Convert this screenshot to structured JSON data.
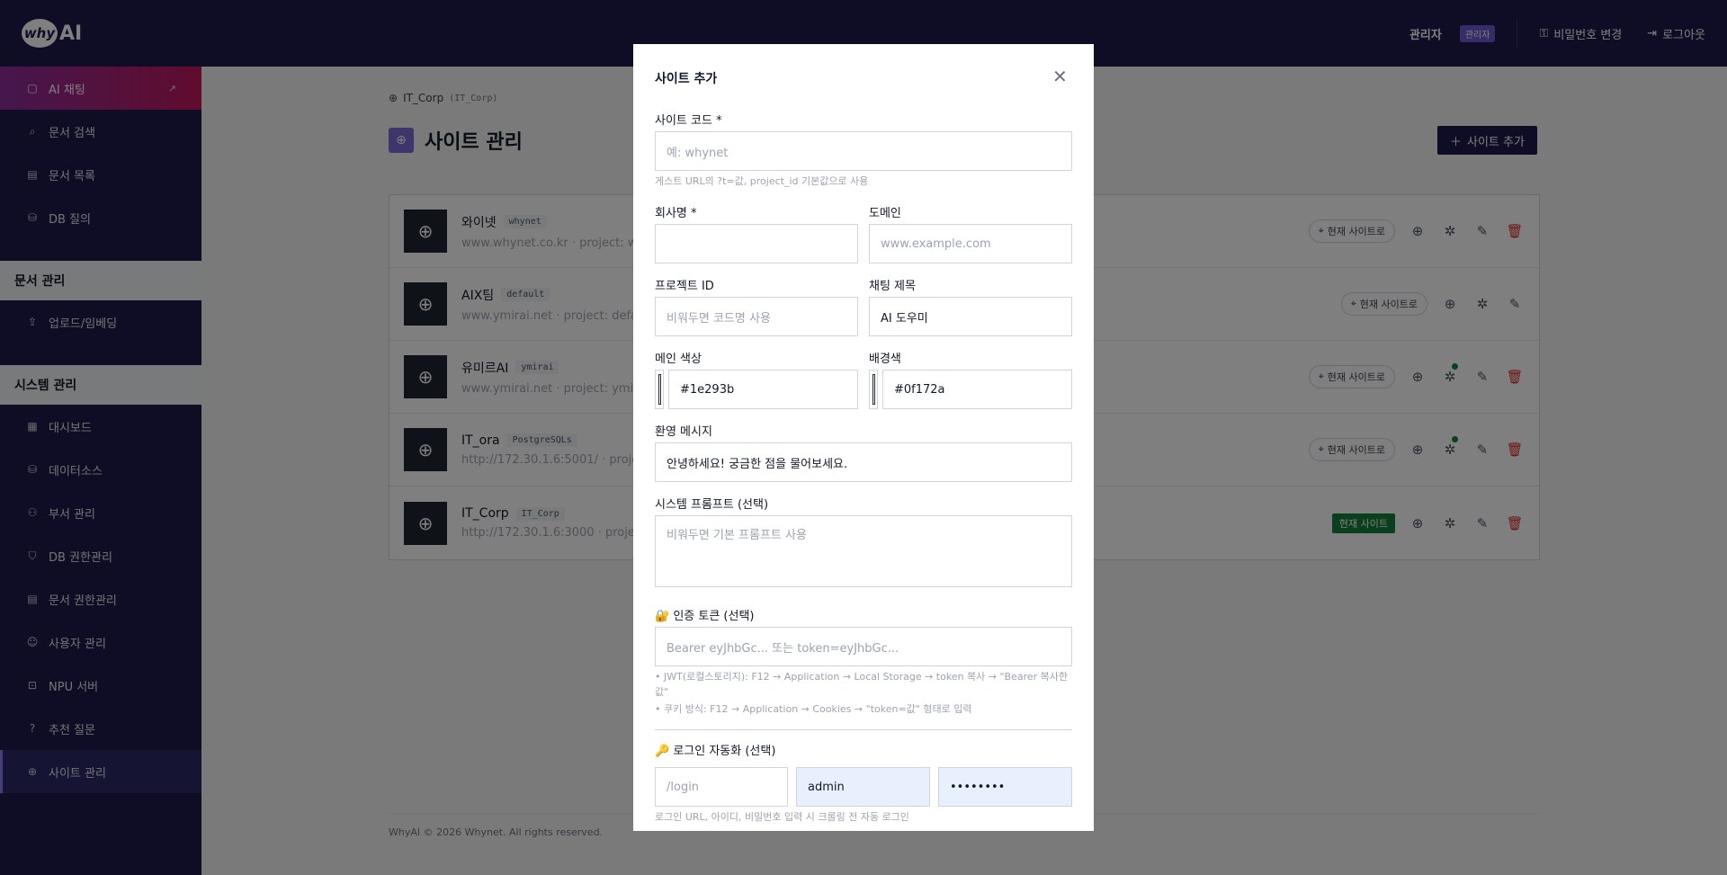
{
  "header": {
    "logo": "AI",
    "logo_mark": "why",
    "user": "관리자",
    "role_badge": "관리자",
    "change_password": "비밀번호 변경",
    "logout": "로그아웃"
  },
  "sidebar": {
    "chat": "AI 채팅",
    "items_top": [
      "문서 검색",
      "문서 목록",
      "DB 질의"
    ],
    "section1": "문서 관리",
    "items_doc": [
      "업로드/임베딩"
    ],
    "section2": "시스템 관리",
    "items_sys": [
      "대시보드",
      "데이터소스",
      "부서 관리",
      "DB 권한관리",
      "문서 권한관리",
      "사용자 관리",
      "NPU 서버",
      "추천 질문",
      "사이트 관리"
    ]
  },
  "main": {
    "breadcrumb": "IT_Corp",
    "breadcrumb_code": "(IT_Corp)",
    "title": "사이트 관리",
    "add_button": "사이트 추가",
    "sites": [
      {
        "name": "와이넷",
        "code": "whynet",
        "sub": "www.whynet.co.kr · project: wh",
        "current": false,
        "deletable": true,
        "dot": false
      },
      {
        "name": "AIX팀",
        "code": "default",
        "sub": "www.ymirai.net · project: defau",
        "current": false,
        "deletable": false,
        "dot": false
      },
      {
        "name": "유미르AI",
        "code": "ymirai",
        "sub": "www.ymirai.net · project: ymira",
        "current": false,
        "deletable": true,
        "dot": true
      },
      {
        "name": "IT_ora",
        "code": "PostgreSQLs",
        "sub": "http://172.30.1.6:5001/ · project",
        "current": false,
        "deletable": true,
        "dot": true
      },
      {
        "name": "IT_Corp",
        "code": "IT_Corp",
        "sub": "http://172.30.1.6:3000 · project",
        "current": true,
        "deletable": true,
        "dot": false
      }
    ],
    "goto_site": "현재 사이트로",
    "current_site": "현재 사이트",
    "footer": "WhyAI © 2026 Whynet. All rights reserved."
  },
  "modal": {
    "title": "사이트 추가",
    "site_code_label": "사이트 코드 *",
    "site_code_placeholder": "예: whynet",
    "site_code_hint": "게스트 URL의 ?t=값, project_id 기본값으로 사용",
    "company_label": "회사명 *",
    "company_value": "",
    "domain_label": "도메인",
    "domain_placeholder": "www.example.com",
    "project_label": "프로젝트 ID",
    "project_placeholder": "비워두면 코드명 사용",
    "chat_title_label": "채팅 제목",
    "chat_title_value": "AI 도우미",
    "main_color_label": "메인 색상",
    "main_color_value": "#1e293b",
    "bg_color_label": "배경색",
    "bg_color_value": "#0f172a",
    "welcome_label": "환영 메시지",
    "welcome_value": "안녕하세요! 궁금한 점을 물어보세요.",
    "prompt_label": "시스템 프롬프트 (선택)",
    "prompt_placeholder": "비워두면 기본 프롬프트 사용",
    "token_label": "🔐 인증 토큰 (선택)",
    "token_placeholder": "Bearer eyJhbGc... 또는 token=eyJhbGc...",
    "token_hint1": "• JWT(로컬스토리지): F12 → Application → Local Storage → token 복사 → \"Bearer 복사한 값\"",
    "token_hint2": "• 쿠키 방식: F12 → Application → Cookies → \"token=값\" 형태로 입력",
    "login_label": "🔑 로그인 자동화 (선택)",
    "login_url_placeholder": "/login",
    "login_id_value": "admin",
    "login_pw_value": "••••••••",
    "login_hint": "로그인 URL, 아이디, 비밀번호 입력 시 크롤링 전 자동 로그인"
  }
}
